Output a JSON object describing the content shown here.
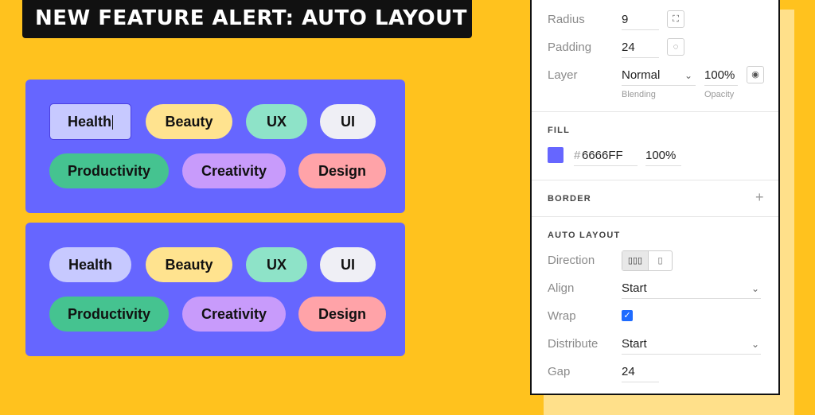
{
  "banner": {
    "title": "NEW FEATURE ALERT: AUTO LAYOUT"
  },
  "tags": {
    "health": "Health",
    "beauty": "Beauty",
    "ux": "UX",
    "ui": "UI",
    "productivity": "Productivity",
    "creativity": "Creativity",
    "design": "Design"
  },
  "panel": {
    "radius": {
      "label": "Radius",
      "value": "9"
    },
    "padding": {
      "label": "Padding",
      "value": "24"
    },
    "layer": {
      "label": "Layer",
      "blending_value": "Normal",
      "blending_caption": "Blending",
      "opacity_value": "100%",
      "opacity_caption": "Opacity"
    },
    "fill": {
      "title": "FILL",
      "hash": "#",
      "hex": "6666FF",
      "opacity": "100%",
      "color": "#6666FF"
    },
    "border": {
      "title": "BORDER"
    },
    "auto_layout": {
      "title": "AUTO LAYOUT",
      "direction_label": "Direction",
      "align_label": "Align",
      "align_value": "Start",
      "wrap_label": "Wrap",
      "wrap_checked": true,
      "distribute_label": "Distribute",
      "distribute_value": "Start",
      "gap_label": "Gap",
      "gap_value": "24"
    }
  },
  "colors": {
    "background": "#FFC21E",
    "card": "#6666FF",
    "tag_health": "#C7C9FF",
    "tag_beauty": "#FFE38F",
    "tag_ux": "#8EE3C8",
    "tag_ui": "#EFEFF5",
    "tag_productivity": "#45C390",
    "tag_creativity": "#C89BFB",
    "tag_design": "#FFA3A8",
    "checkbox": "#1E6BFF"
  }
}
